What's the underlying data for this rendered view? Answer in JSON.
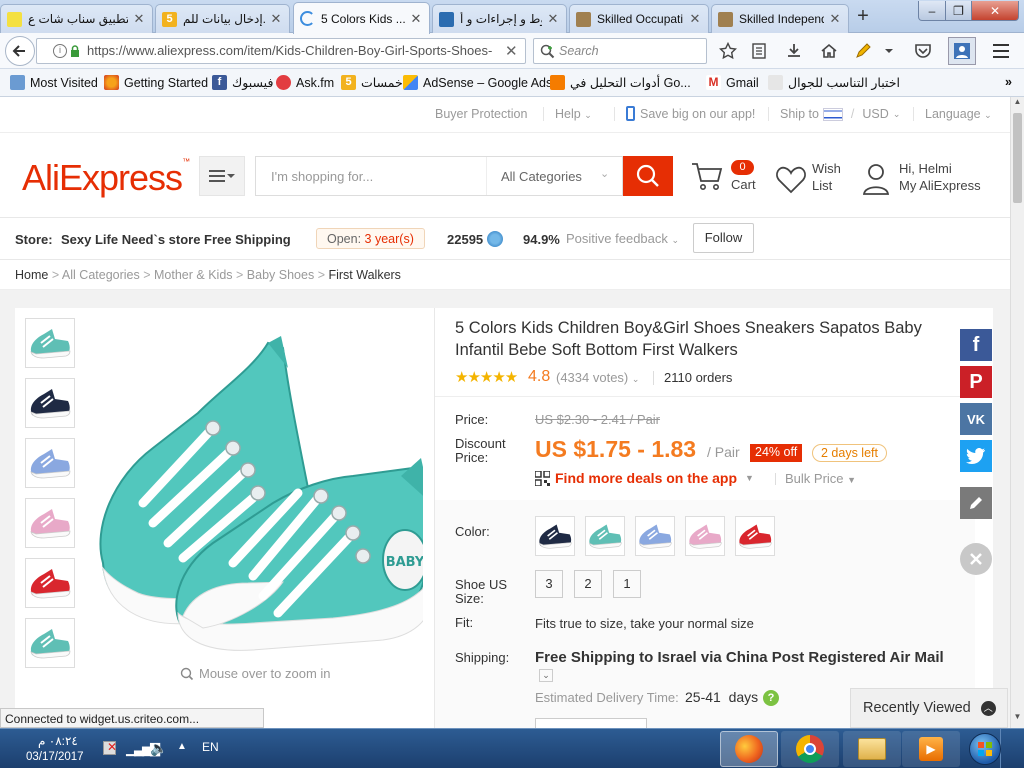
{
  "browser": {
    "tabs": [
      {
        "label": "تطبيق سناب شات ع...",
        "active": false
      },
      {
        "label": "إدخال بيانات للم...",
        "active": false
      },
      {
        "label": "5 Colors Kids ...",
        "active": true
      },
      {
        "label": "شروط و إجراءات و أ...",
        "active": false
      },
      {
        "label": "Skilled Occupati...",
        "active": false
      },
      {
        "label": "Skilled Independ...",
        "active": false
      }
    ],
    "url": "https://www.aliexpress.com/item/Kids-Children-Boy-Girl-Sports-Shoes-",
    "search_placeholder": "Search",
    "bookmarks": [
      "Most Visited",
      "Getting Started",
      "فيسبوك",
      "Ask.fm",
      "خمسات",
      "AdSense – Google Ads",
      "أدوات التحليل في Go...",
      "Gmail",
      "اختبار التناسب للجوال"
    ]
  },
  "topstrip": {
    "buyer_protection": "Buyer Protection",
    "help": "Help",
    "save_app": "Save big on our app!",
    "ship_to": "Ship to",
    "currency": "USD",
    "language": "Language"
  },
  "header": {
    "logo": "AliExpress",
    "search_placeholder": "I'm shopping for...",
    "category": "All Categories",
    "cart_label": "Cart",
    "cart_count": "0",
    "wish_line1": "Wish",
    "wish_line2": "List",
    "greeting": "Hi, Helmi",
    "account": "My AliExpress"
  },
  "store": {
    "label": "Store:",
    "name": "Sexy Life Need`s store Free Shipping",
    "open_label": "Open:",
    "open_value": "3 year(s)",
    "score": "22595",
    "feedback_pct": "94.9%",
    "feedback_label": "Positive feedback",
    "follow": "Follow"
  },
  "breadcrumb": [
    "Home",
    "All Categories",
    "Mother & Kids",
    "Baby Shoes",
    "First Walkers"
  ],
  "product": {
    "title_line1": "5 Colors Kids Children Boy&Girl Shoes Sneakers Sapatos Baby",
    "title_line2": "Infantil Bebe Soft Bottom First Walkers",
    "rating": "4.8",
    "votes": "(4334 votes)",
    "orders": "2110 orders",
    "price_label": "Price:",
    "old_price": "US $2.30 - 2.41 / Pair",
    "discount_label_1": "Discount",
    "discount_label_2": "Price:",
    "price": "US $1.75 - 1.83",
    "unit": "/ Pair",
    "off_badge": "24% off",
    "days_left": "2 days left",
    "app_deals": "Find more deals on the app",
    "bulk_price": "Bulk Price",
    "color_label": "Color:",
    "size_label_1": "Shoe US",
    "size_label_2": "Size:",
    "sizes": [
      "3",
      "2",
      "1"
    ],
    "fit_label": "Fit:",
    "fit_value": "Fits true to size, take your normal size",
    "shipping_label": "Shipping:",
    "shipping_free": "Free Shipping to",
    "shipping_dest": "Israel via China Post Registered Air Mail",
    "delivery_label": "Estimated Delivery Time:",
    "delivery_value": "25-41",
    "delivery_unit": "days",
    "zoom_hint": "Mouse over to zoom in",
    "recently_viewed": "Recently Viewed"
  },
  "thumb_colors": [
    "#5fbfb5",
    "#1f2a44",
    "#8aa8e0",
    "#e8a9c8",
    "#d9262e",
    "#5fbfb5"
  ],
  "option_colors": [
    "#1f2a44",
    "#5fbfb5",
    "#8aa8e0",
    "#e8a9c8",
    "#d9262e"
  ],
  "status_text": "Connected to widget.us.criteo.com...",
  "taskbar": {
    "time": "٠٨:٢٤ م",
    "date": "03/17/2017",
    "lang": "EN"
  },
  "colors": {
    "ali_red": "#e62e04",
    "ali_orange": "#f47b20",
    "share_fb": "#3b5998",
    "share_pin": "#cb2027",
    "share_vk": "#4c75a3",
    "share_tw": "#1da1f2"
  }
}
